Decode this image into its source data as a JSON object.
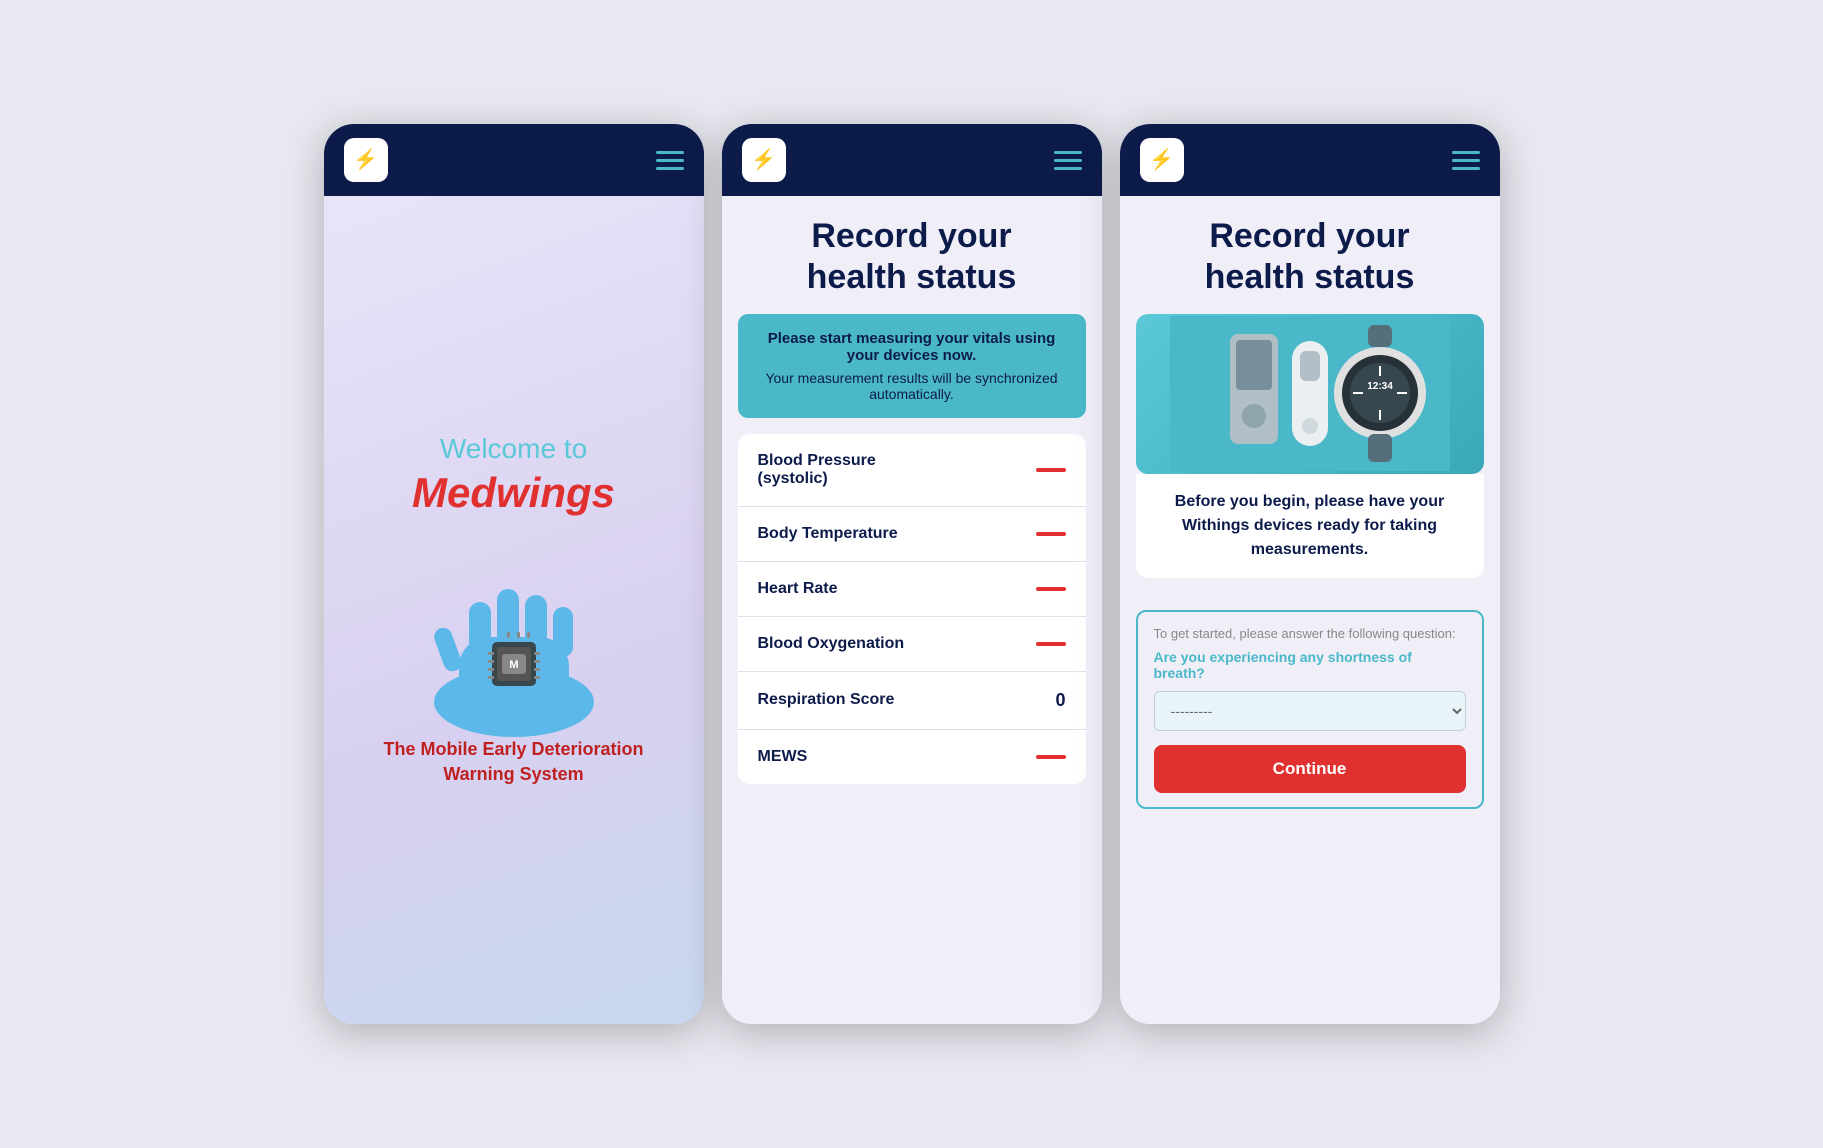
{
  "app": {
    "logo_symbol": "♥",
    "hamburger_aria": "Open menu"
  },
  "screen1": {
    "welcome_line1": "Welcome to",
    "welcome_line2": "Medwings",
    "subtitle": "The Mobile Early Deterioration Warning System"
  },
  "screen2": {
    "title_line1": "Record your",
    "title_line2": "health status",
    "info_main": "Please start measuring your vitals using your devices now.",
    "info_sub": "Your measurement results will be synchronized automatically.",
    "vitals": [
      {
        "name": "Blood Pressure (systolic)",
        "value": "dash"
      },
      {
        "name": "Body Temperature",
        "value": "dash"
      },
      {
        "name": "Heart Rate",
        "value": "dash"
      },
      {
        "name": "Blood Oxygenation",
        "value": "dash"
      },
      {
        "name": "Respiration Score",
        "value": "0"
      },
      {
        "name": "MEWS",
        "value": "dash"
      }
    ]
  },
  "screen3": {
    "title_line1": "Record your",
    "title_line2": "health status",
    "before_text": "Before you begin, please have your Withings devices ready for taking measurements.",
    "question_prompt": "To get started, please answer the following question:",
    "question_text": "Are you experiencing any shortness of breath?",
    "select_default": "---------",
    "continue_label": "Continue"
  }
}
